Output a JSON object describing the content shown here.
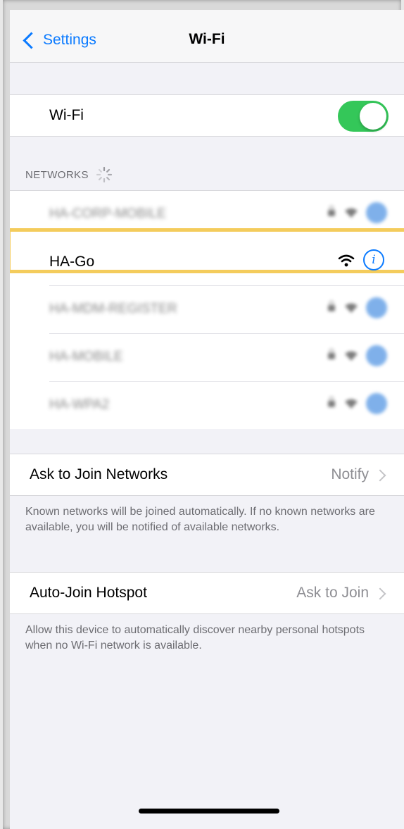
{
  "navbar": {
    "back_label": "Settings",
    "title": "Wi-Fi"
  },
  "wifi_toggle": {
    "label": "Wi-Fi",
    "state": "on"
  },
  "networks": {
    "header": "NETWORKS",
    "items": [
      {
        "name": "HA-CORP-MOBILE",
        "blurred": true
      },
      {
        "name": "HA-Go",
        "blurred": false,
        "connected": true
      },
      {
        "name": "HA-MDM-REGISTER",
        "blurred": true
      },
      {
        "name": "HA-MOBILE",
        "blurred": true
      },
      {
        "name": "HA-WPA2",
        "blurred": true
      }
    ]
  },
  "ask_to_join": {
    "label": "Ask to Join Networks",
    "value": "Notify",
    "footnote": "Known networks will be joined automatically. If no known networks are available, you will be notified of available networks."
  },
  "auto_join_hotspot": {
    "label": "Auto-Join Hotspot",
    "value": "Ask to Join",
    "footnote": "Allow this device to automatically discover nearby personal hotspots when no Wi-Fi network is available."
  },
  "colors": {
    "accent": "#0a7aff",
    "toggle_on": "#34c759",
    "highlight": "#f4cc5c"
  },
  "icons": [
    "chevron-left-icon",
    "spinner-icon",
    "lock-icon",
    "wifi-icon",
    "info-icon",
    "chevron-right-icon"
  ]
}
